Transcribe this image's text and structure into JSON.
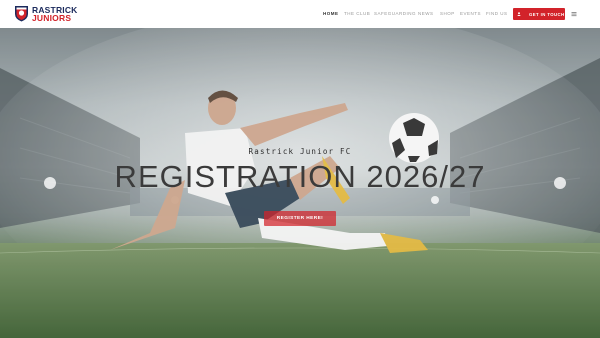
{
  "brand": {
    "line1": "RASTRICK",
    "line2": "JUNIORS",
    "primary_color": "#1b2a5c",
    "accent_color": "#d2232a"
  },
  "nav": {
    "items": [
      {
        "label": "HOME",
        "active": true
      },
      {
        "label": "THE CLUB",
        "active": false
      },
      {
        "label": "SAFEGUARDING",
        "active": false
      },
      {
        "label": "NEWS",
        "active": false
      },
      {
        "label": "SHOP",
        "active": false
      },
      {
        "label": "EVENTS",
        "active": false
      },
      {
        "label": "FIND US",
        "active": false
      }
    ],
    "cta_label": "GET IN TOUCH",
    "cta_icon": "user-icon",
    "menu_icon": "hamburger-menu-icon"
  },
  "hero": {
    "subtitle": "Rastrick Junior FC",
    "title": "REGISTRATION 2026/27",
    "button_label": "REGISTER HERE!"
  }
}
